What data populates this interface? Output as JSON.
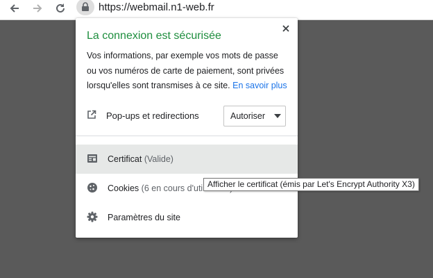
{
  "browser": {
    "url": "https://webmail.n1-web.fr",
    "icons": {
      "back": "back-arrow-icon",
      "forward": "forward-arrow-icon",
      "reload": "reload-icon",
      "lock": "lock-icon"
    }
  },
  "popup": {
    "title": "La connexion est sécurisée",
    "description": "Vos informations, par exemple vos mots de passe ou vos numéros de carte de paiement, sont privées lorsqu'elles sont transmises à ce site.",
    "learn_more": "En savoir plus",
    "permission": {
      "label": "Pop-ups et redirections",
      "value": "Autoriser",
      "icon": "external-link-icon"
    },
    "items": [
      {
        "label": "Certificat",
        "sub": "(Valide)",
        "icon": "certificate-icon"
      },
      {
        "label": "Cookies",
        "sub": "(6 en cours d'utilisation)",
        "icon": "cookie-icon"
      },
      {
        "label": "Paramètres du site",
        "sub": "",
        "icon": "gear-icon"
      }
    ]
  },
  "tooltip": "Afficher le certificat (émis par Let's Encrypt Authority X3)",
  "colors": {
    "secure_title": "#1e8e3e",
    "link": "#1a73e8",
    "backdrop": "#5a5a5a",
    "hover_row": "#e6e8e7"
  }
}
